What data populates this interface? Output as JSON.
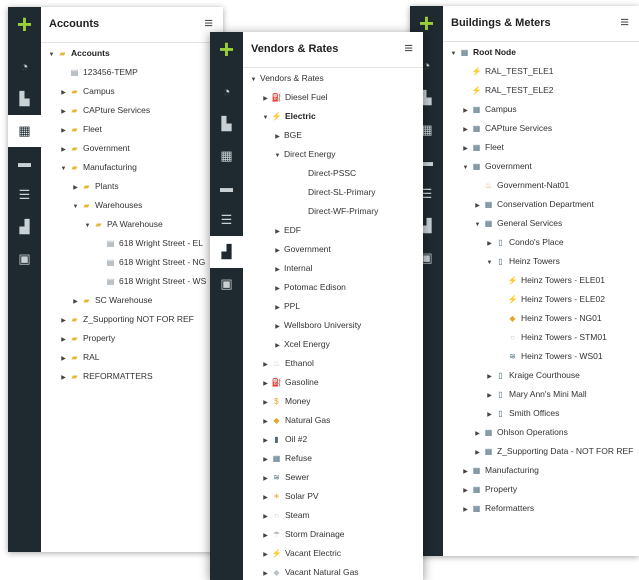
{
  "panels": {
    "accounts": {
      "title": "Accounts",
      "items": [
        {
          "label": "Accounts",
          "indent": 0,
          "caret": "▼",
          "icon": "▰",
          "cls": "folder",
          "bold": true
        },
        {
          "label": "123456-TEMP",
          "indent": 1,
          "caret": "",
          "icon": "▤",
          "cls": "doc"
        },
        {
          "label": "Campus",
          "indent": 1,
          "caret": "▶",
          "icon": "▰",
          "cls": "folder"
        },
        {
          "label": "CAPture Services",
          "indent": 1,
          "caret": "▶",
          "icon": "▰",
          "cls": "folder"
        },
        {
          "label": "Fleet",
          "indent": 1,
          "caret": "▶",
          "icon": "▰",
          "cls": "folder"
        },
        {
          "label": "Government",
          "indent": 1,
          "caret": "▶",
          "icon": "▰",
          "cls": "folder"
        },
        {
          "label": "Manufacturing",
          "indent": 1,
          "caret": "▼",
          "icon": "▰",
          "cls": "folder"
        },
        {
          "label": "Plants",
          "indent": 2,
          "caret": "▶",
          "icon": "▰",
          "cls": "folder"
        },
        {
          "label": "Warehouses",
          "indent": 2,
          "caret": "▼",
          "icon": "▰",
          "cls": "folder"
        },
        {
          "label": "PA Warehouse",
          "indent": 3,
          "caret": "▼",
          "icon": "▰",
          "cls": "folder"
        },
        {
          "label": "618 Wright Street - EL",
          "indent": 4,
          "caret": "",
          "icon": "▤",
          "cls": "doc"
        },
        {
          "label": "618 Wright Street - NG",
          "indent": 4,
          "caret": "",
          "icon": "▤",
          "cls": "doc"
        },
        {
          "label": "618 Wright Street - WS",
          "indent": 4,
          "caret": "",
          "icon": "▤",
          "cls": "doc"
        },
        {
          "label": "SC Warehouse",
          "indent": 2,
          "caret": "▶",
          "icon": "▰",
          "cls": "folder"
        },
        {
          "label": "Z_Supporting NOT FOR REF",
          "indent": 1,
          "caret": "▶",
          "icon": "▰",
          "cls": "folder"
        },
        {
          "label": "Property",
          "indent": 1,
          "caret": "▶",
          "icon": "▰",
          "cls": "folder"
        },
        {
          "label": "RAL",
          "indent": 1,
          "caret": "▶",
          "icon": "▰",
          "cls": "folder"
        },
        {
          "label": "REFORMATTERS",
          "indent": 1,
          "caret": "▶",
          "icon": "▰",
          "cls": "folder"
        }
      ]
    },
    "vendors": {
      "title": "Vendors & Rates",
      "items": [
        {
          "label": "Vendors & Rates",
          "indent": 0,
          "caret": "▼",
          "icon": "",
          "cls": ""
        },
        {
          "label": "Diesel Fuel",
          "indent": 1,
          "caret": "▶",
          "icon": "⛽",
          "cls": "flash"
        },
        {
          "label": "Electric",
          "indent": 1,
          "caret": "▼",
          "icon": "⚡",
          "cls": "flash",
          "bold": true
        },
        {
          "label": "BGE",
          "indent": 2,
          "caret": "▶",
          "icon": "",
          "cls": ""
        },
        {
          "label": "Direct Energy",
          "indent": 2,
          "caret": "▼",
          "icon": "",
          "cls": ""
        },
        {
          "label": "Direct-PSSC",
          "indent": 4,
          "caret": "",
          "icon": "",
          "cls": ""
        },
        {
          "label": "Direct-SL-Primary",
          "indent": 4,
          "caret": "",
          "icon": "",
          "cls": ""
        },
        {
          "label": "Direct-WF-Primary",
          "indent": 4,
          "caret": "",
          "icon": "",
          "cls": ""
        },
        {
          "label": "EDF",
          "indent": 2,
          "caret": "▶",
          "icon": "",
          "cls": ""
        },
        {
          "label": "Government",
          "indent": 2,
          "caret": "▶",
          "icon": "",
          "cls": ""
        },
        {
          "label": "Internal",
          "indent": 2,
          "caret": "▶",
          "icon": "",
          "cls": ""
        },
        {
          "label": "Potomac Edison",
          "indent": 2,
          "caret": "▶",
          "icon": "",
          "cls": ""
        },
        {
          "label": "PPL",
          "indent": 2,
          "caret": "▶",
          "icon": "",
          "cls": ""
        },
        {
          "label": "Wellsboro University",
          "indent": 2,
          "caret": "▶",
          "icon": "",
          "cls": ""
        },
        {
          "label": "Xcel Energy",
          "indent": 2,
          "caret": "▶",
          "icon": "",
          "cls": ""
        },
        {
          "label": "Ethanol",
          "indent": 1,
          "caret": "▶",
          "icon": "♨",
          "cls": "grey"
        },
        {
          "label": "Gasoline",
          "indent": 1,
          "caret": "▶",
          "icon": "⛽",
          "cls": "flash"
        },
        {
          "label": "Money",
          "indent": 1,
          "caret": "▶",
          "icon": "$",
          "cls": "flash"
        },
        {
          "label": "Natural Gas",
          "indent": 1,
          "caret": "▶",
          "icon": "◆",
          "cls": "flash"
        },
        {
          "label": "Oil #2",
          "indent": 1,
          "caret": "▶",
          "icon": "▮",
          "cls": "bld"
        },
        {
          "label": "Refuse",
          "indent": 1,
          "caret": "▶",
          "icon": "▦",
          "cls": "bld"
        },
        {
          "label": "Sewer",
          "indent": 1,
          "caret": "▶",
          "icon": "≋",
          "cls": "bld"
        },
        {
          "label": "Solar PV",
          "indent": 1,
          "caret": "▶",
          "icon": "☀",
          "cls": "flash"
        },
        {
          "label": "Steam",
          "indent": 1,
          "caret": "▶",
          "icon": "○",
          "cls": "grey"
        },
        {
          "label": "Storm Drainage",
          "indent": 1,
          "caret": "▶",
          "icon": "☂",
          "cls": "grey"
        },
        {
          "label": "Vacant Electric",
          "indent": 1,
          "caret": "▶",
          "icon": "⚡",
          "cls": "grey"
        },
        {
          "label": "Vacant Natural Gas",
          "indent": 1,
          "caret": "▶",
          "icon": "◆",
          "cls": "grey"
        }
      ]
    },
    "buildings": {
      "title": "Buildings & Meters",
      "items": [
        {
          "label": "Root Node",
          "indent": 0,
          "caret": "▼",
          "icon": "▦",
          "cls": "bld",
          "bold": true
        },
        {
          "label": "RAL_TEST_ELE1",
          "indent": 1,
          "caret": "",
          "icon": "⚡",
          "cls": "flash"
        },
        {
          "label": "RAL_TEST_ELE2",
          "indent": 1,
          "caret": "",
          "icon": "⚡",
          "cls": "flash"
        },
        {
          "label": "Campus",
          "indent": 1,
          "caret": "▶",
          "icon": "▦",
          "cls": "bld"
        },
        {
          "label": "CAPture Services",
          "indent": 1,
          "caret": "▶",
          "icon": "▦",
          "cls": "bld"
        },
        {
          "label": "Fleet",
          "indent": 1,
          "caret": "▶",
          "icon": "▦",
          "cls": "bld"
        },
        {
          "label": "Government",
          "indent": 1,
          "caret": "▼",
          "icon": "▦",
          "cls": "bld"
        },
        {
          "label": "Government-Nat01",
          "indent": 2,
          "caret": "",
          "icon": "♨",
          "cls": "flash"
        },
        {
          "label": "Conservation Department",
          "indent": 2,
          "caret": "▶",
          "icon": "▦",
          "cls": "bld"
        },
        {
          "label": "General Services",
          "indent": 2,
          "caret": "▼",
          "icon": "▦",
          "cls": "bld"
        },
        {
          "label": "Condo's Place",
          "indent": 3,
          "caret": "▶",
          "icon": "▯",
          "cls": "bld"
        },
        {
          "label": "Heinz Towers",
          "indent": 3,
          "caret": "▼",
          "icon": "▯",
          "cls": "bld"
        },
        {
          "label": "Heinz Towers - ELE01",
          "indent": 4,
          "caret": "",
          "icon": "⚡",
          "cls": "flash"
        },
        {
          "label": "Heinz Towers - ELE02",
          "indent": 4,
          "caret": "",
          "icon": "⚡",
          "cls": "flash"
        },
        {
          "label": "Heinz Towers - NG01",
          "indent": 4,
          "caret": "",
          "icon": "◆",
          "cls": "flash"
        },
        {
          "label": "Heinz Towers - STM01",
          "indent": 4,
          "caret": "",
          "icon": "○",
          "cls": "grey"
        },
        {
          "label": "Heinz Towers - WS01",
          "indent": 4,
          "caret": "",
          "icon": "≋",
          "cls": "bld"
        },
        {
          "label": "Kraige Courthouse",
          "indent": 3,
          "caret": "▶",
          "icon": "▯",
          "cls": "bld"
        },
        {
          "label": "Mary Ann's Mini Mall",
          "indent": 3,
          "caret": "▶",
          "icon": "▯",
          "cls": "bld"
        },
        {
          "label": "Smith Offices",
          "indent": 3,
          "caret": "▶",
          "icon": "▯",
          "cls": "bld"
        },
        {
          "label": "Ohlson Operations",
          "indent": 2,
          "caret": "▶",
          "icon": "▦",
          "cls": "bld"
        },
        {
          "label": "Z_Supporting Data - NOT FOR REF",
          "indent": 2,
          "caret": "▶",
          "icon": "▦",
          "cls": "bld"
        },
        {
          "label": "Manufacturing",
          "indent": 1,
          "caret": "▶",
          "icon": "▦",
          "cls": "bld"
        },
        {
          "label": "Property",
          "indent": 1,
          "caret": "▶",
          "icon": "▦",
          "cls": "bld"
        },
        {
          "label": "Reformatters",
          "indent": 1,
          "caret": "▶",
          "icon": "▦",
          "cls": "bld"
        }
      ]
    }
  },
  "rail_icons": {
    "add": "+",
    "dashboard": "◔",
    "buildings": "▙",
    "calculator": "▦",
    "card": "▬",
    "filter": "☰",
    "factory": "▟",
    "reports": "▣"
  },
  "menu_glyph": "≡",
  "colors": {
    "rail": "#1e2a30",
    "accent": "#9bcf3a",
    "folder": "#e2b731"
  }
}
